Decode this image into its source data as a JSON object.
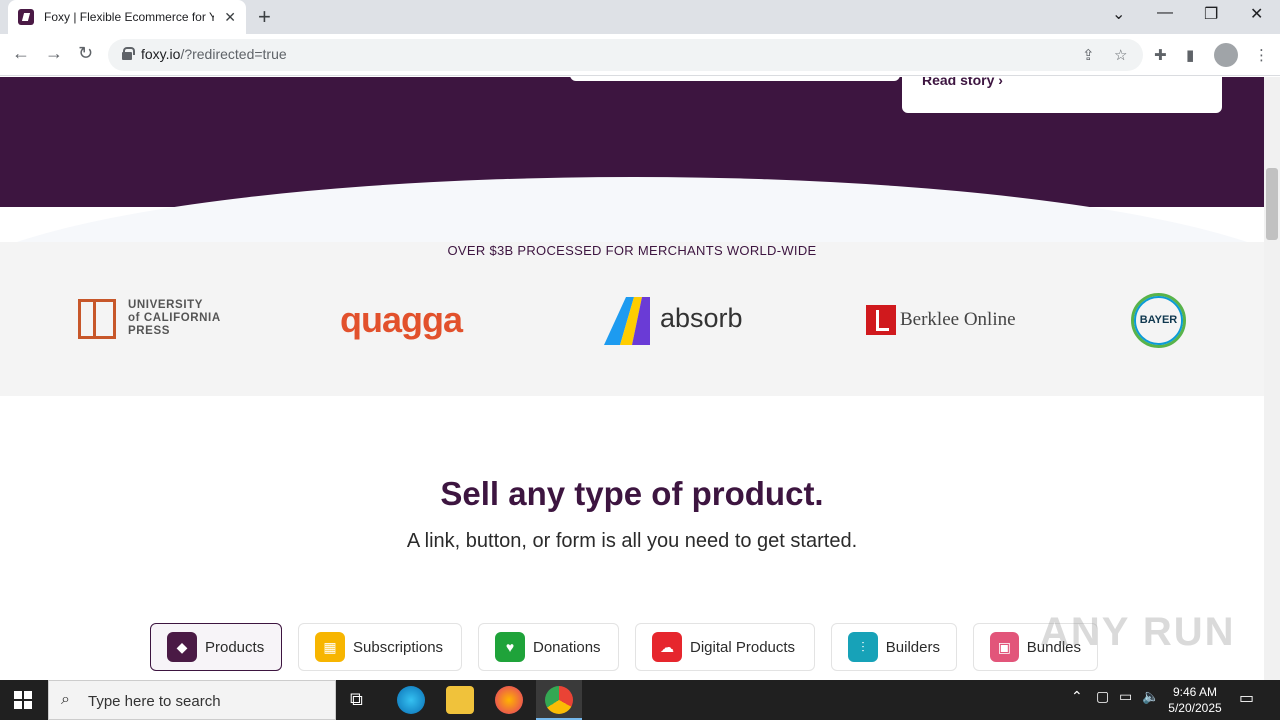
{
  "browser": {
    "tab_title": "Foxy | Flexible Ecommerce for Y",
    "tab_close": "✕",
    "new_tab": "+",
    "url_host": "foxy.io",
    "url_rest": "/?redirected=true",
    "window": {
      "minimize": "—",
      "restore": "❐",
      "close": "✕",
      "tabsearch": "⌄"
    }
  },
  "page": {
    "hero_link": "Read story",
    "logos_heading": "OVER $3B PROCESSED FOR MERCHANTS WORLD-WIDE",
    "logos": {
      "ucp": [
        "UNIVERSITY",
        "of CALIFORNIA",
        "PRESS"
      ],
      "quagga": "quagga",
      "absorb": "absorb",
      "berklee": "Berklee Online",
      "bayer": "BAYER"
    },
    "headline": "Sell any type of product.",
    "subhead": "A link, button, or form is all you need to get started.",
    "tabs": [
      {
        "label": "Products",
        "color": "#4a1a45",
        "icon": "tag-icon"
      },
      {
        "label": "Subscriptions",
        "color": "#f7b500",
        "icon": "calendar-icon"
      },
      {
        "label": "Donations",
        "color": "#1fa33a",
        "icon": "heart-icon"
      },
      {
        "label": "Digital Products",
        "color": "#e6262d",
        "icon": "cloud-download-icon"
      },
      {
        "label": "Builders",
        "color": "#17a2b8",
        "icon": "sliders-icon"
      },
      {
        "label": "Bundles",
        "color": "#e2557a",
        "icon": "boxes-icon"
      }
    ]
  },
  "taskbar": {
    "search_placeholder": "Type here to search",
    "time": "9:46 AM",
    "date": "5/20/2025"
  },
  "watermark": "ANY RUN"
}
